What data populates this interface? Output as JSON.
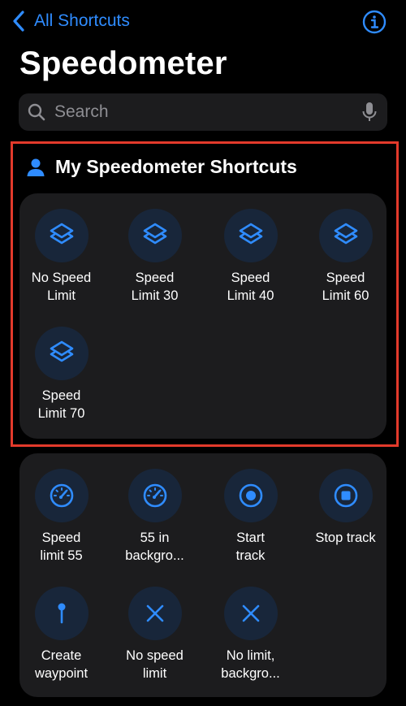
{
  "nav": {
    "back_label": "All Shortcuts"
  },
  "title": "Speedometer",
  "search": {
    "placeholder": "Search"
  },
  "my_section": {
    "title": "My Speedometer Shortcuts",
    "shortcuts": [
      {
        "label": "No Speed\nLimit",
        "icon": "layers-icon"
      },
      {
        "label": "Speed\nLimit 30",
        "icon": "layers-icon"
      },
      {
        "label": "Speed\nLimit 40",
        "icon": "layers-icon"
      },
      {
        "label": "Speed\nLimit 60",
        "icon": "layers-icon"
      },
      {
        "label": "Speed\nLimit 70",
        "icon": "layers-icon"
      }
    ]
  },
  "app_section": {
    "shortcuts": [
      {
        "label": "Speed\nlimit 55",
        "icon": "speedometer-icon"
      },
      {
        "label": "55 in\nbackgro...",
        "icon": "speedometer-icon"
      },
      {
        "label": "Start\ntrack",
        "icon": "record-icon"
      },
      {
        "label": "Stop track",
        "icon": "stop-icon"
      },
      {
        "label": "Create\nwaypoint",
        "icon": "pin-icon"
      },
      {
        "label": "No speed\nlimit",
        "icon": "x-icon"
      },
      {
        "label": "No limit,\nbackgro...",
        "icon": "x-icon"
      }
    ]
  },
  "colors": {
    "accent": "#2f8cff",
    "background": "#000000",
    "card": "#1c1c1e",
    "tile_circle": "#18263a",
    "highlight_border": "#e33a2b"
  }
}
